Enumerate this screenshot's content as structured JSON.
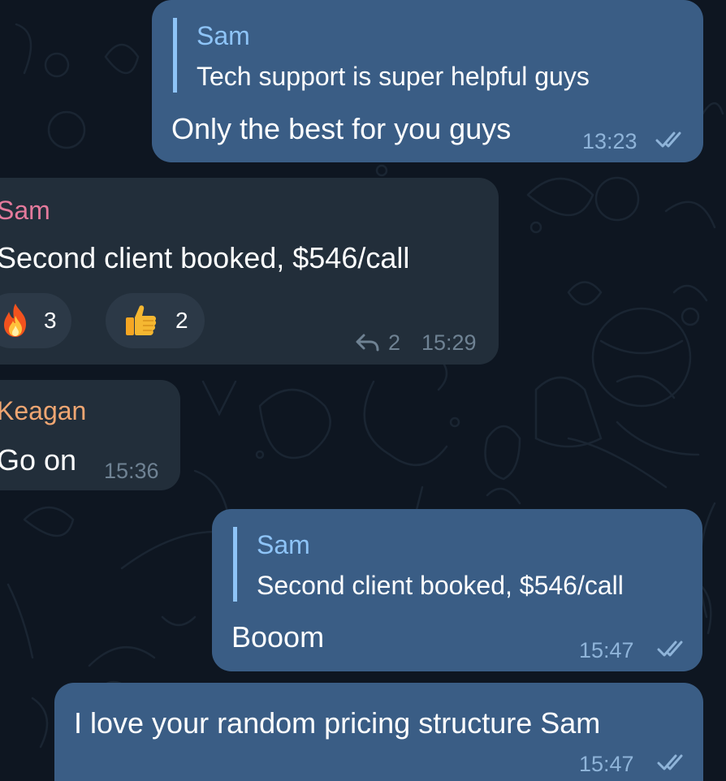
{
  "colors": {
    "background": "#0e1621",
    "outgoing_bubble": "#3a5d85",
    "incoming_bubble": "#222e3a",
    "reply_accent": "#8ec4f7",
    "sender_sam": "#e57a9c",
    "sender_keagan": "#f0a672",
    "read_ticks": "#8fb4d9"
  },
  "messages": [
    {
      "direction": "outgoing",
      "reply_to": {
        "name": "Sam",
        "text": "Tech support is super helpful guys"
      },
      "text": "Only the best for you guys",
      "time": "13:23",
      "status_icon": "double-check-icon"
    },
    {
      "direction": "incoming",
      "sender": "Sam",
      "text": "Second client booked, $546/call",
      "reactions": [
        {
          "emoji": "fire-emoji",
          "count": "3"
        },
        {
          "emoji": "thumbs-up-emoji",
          "count": "2"
        }
      ],
      "replies_count": "2",
      "replies_icon": "reply-arrow-icon",
      "time": "15:29"
    },
    {
      "direction": "incoming",
      "sender": "Keagan",
      "text": "Go on",
      "time": "15:36"
    },
    {
      "direction": "outgoing",
      "reply_to": {
        "name": "Sam",
        "text": "Second client booked, $546/call"
      },
      "text": "Booom",
      "time": "15:47",
      "status_icon": "double-check-icon"
    },
    {
      "direction": "outgoing",
      "text": "I love your random pricing structure Sam",
      "time": "15:47",
      "status_icon": "double-check-icon"
    }
  ]
}
